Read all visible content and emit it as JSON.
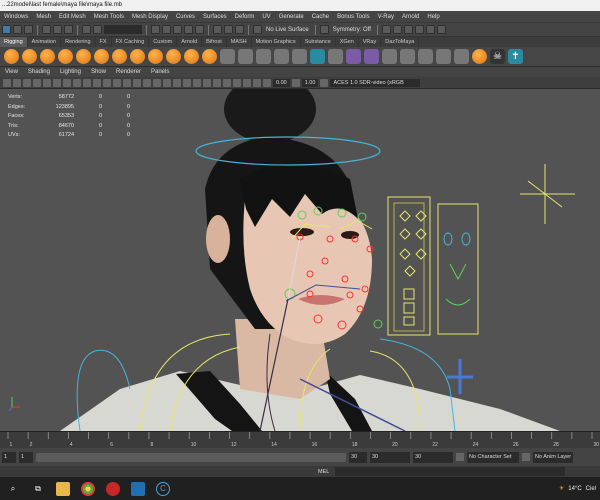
{
  "window": {
    "title": "...22model\\last female\\maya file\\maya file.mb"
  },
  "menus": [
    "Windows",
    "Mesh",
    "Edit Mesh",
    "Mesh Tools",
    "Mesh Display",
    "Curves",
    "Surfaces",
    "Deform",
    "UV",
    "Generate",
    "Cache",
    "Bonus Tools",
    "V-Ray",
    "Arnold",
    "Help"
  ],
  "statusline": {
    "live_surface": "No Live Surface",
    "symmetry": "Symmetry: Off"
  },
  "shelf_tabs": [
    "Rigging",
    "Animation",
    "Rendering",
    "FX",
    "FX Caching",
    "Custom",
    "Arnold",
    "Bifrost",
    "MASH",
    "Motion Graphics",
    "Substance",
    "XGen",
    "VRay",
    "DazToMaya"
  ],
  "shelf_active_tab": "Rigging",
  "panel_menu": [
    "View",
    "Shading",
    "Lighting",
    "Show",
    "Renderer",
    "Panels"
  ],
  "panel_toolbar": {
    "gamma": "0.00",
    "exposure": "1.00",
    "color_space": "ACES 1.0 SDR-video (sRGB"
  },
  "hud": [
    {
      "label": "Verts:",
      "value": "58772",
      "a": "0",
      "b": "0"
    },
    {
      "label": "Edges:",
      "value": "123895",
      "a": "0",
      "b": "0"
    },
    {
      "label": "Faces:",
      "value": "65353",
      "a": "0",
      "b": "0"
    },
    {
      "label": "Tris:",
      "value": "84670",
      "a": "0",
      "b": "0"
    },
    {
      "label": "UVs:",
      "value": "61724",
      "a": "0",
      "b": "0"
    }
  ],
  "timeline": {
    "ticks": [
      "1",
      "2",
      "3",
      "4",
      "5",
      "6",
      "7",
      "8",
      "9",
      "10",
      "11",
      "12",
      "13",
      "14",
      "15",
      "16",
      "17",
      "18",
      "19",
      "20",
      "21",
      "22",
      "23",
      "24",
      "25",
      "26",
      "27",
      "28",
      "29",
      "30"
    ]
  },
  "range": {
    "start": "1",
    "start2": "1",
    "end": "30",
    "end2": "30",
    "anim_end": "30",
    "character_set": "No Character Set",
    "anim_layer": "No Anim Layer"
  },
  "command_line": {
    "mel_label": "MEL"
  },
  "taskbar": {
    "temperature": "14°C",
    "weather": "Ciel"
  },
  "colors": {
    "viewport_bg": "#535353",
    "ui_bg": "#444444",
    "active_blue": "#3f7ab0",
    "rig_red": "#ff3030",
    "rig_yellow": "#e6e66a",
    "rig_green": "#5ad25a",
    "rig_cyan": "#46b4dc"
  }
}
